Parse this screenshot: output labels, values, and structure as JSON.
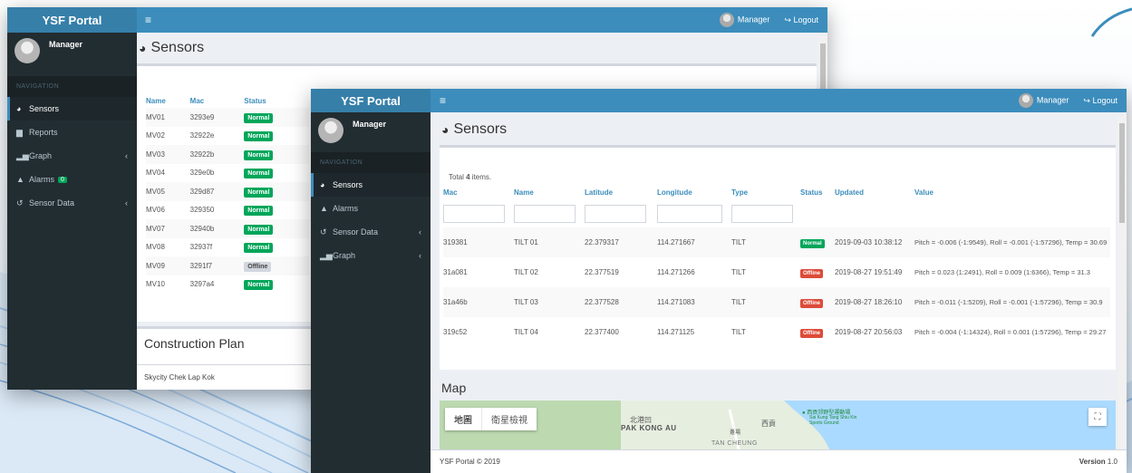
{
  "back": {
    "brand": "YSF Portal",
    "menu_icon": "≡",
    "user": "Manager",
    "logout": "Logout",
    "sidebar_user": "Manager",
    "nav_header": "NAVIGATION",
    "nav": [
      {
        "label": "Sensors",
        "icon": "dashboard-icon",
        "active": true
      },
      {
        "label": "Reports",
        "icon": "file-icon"
      },
      {
        "label": "Graph",
        "icon": "chart-icon",
        "chev": true
      },
      {
        "label": "Alarms",
        "icon": "bell-icon",
        "badge": "0"
      },
      {
        "label": "Sensor Data",
        "icon": "history-icon",
        "chev": true
      }
    ],
    "page_title": "Sensors",
    "columns": [
      "Name",
      "Mac",
      "Status"
    ],
    "rows": [
      {
        "name": "MV01",
        "mac": "3293e9",
        "status": "Normal"
      },
      {
        "name": "MV02",
        "mac": "32922e",
        "status": "Normal"
      },
      {
        "name": "MV03",
        "mac": "32922b",
        "status": "Normal"
      },
      {
        "name": "MV04",
        "mac": "329e0b",
        "status": "Normal"
      },
      {
        "name": "MV05",
        "mac": "329d87",
        "status": "Normal"
      },
      {
        "name": "MV06",
        "mac": "329350",
        "status": "Normal"
      },
      {
        "name": "MV07",
        "mac": "32940b",
        "status": "Normal"
      },
      {
        "name": "MV08",
        "mac": "32937f",
        "status": "Normal"
      },
      {
        "name": "MV09",
        "mac": "3291f7",
        "status": "Offline"
      },
      {
        "name": "MV10",
        "mac": "3297a4",
        "status": "Normal"
      }
    ],
    "section2": "Construction Plan",
    "footer": "Skycity Chek Lap Kok"
  },
  "front": {
    "brand": "YSF Portal",
    "menu_icon": "≡",
    "user": "Manager",
    "logout": "Logout",
    "sidebar_user": "Manager",
    "nav_header": "NAVIGATION",
    "nav": [
      {
        "label": "Sensors",
        "icon": "dashboard-icon",
        "active": true
      },
      {
        "label": "Alarms",
        "icon": "bell-icon"
      },
      {
        "label": "Sensor Data",
        "icon": "history-icon",
        "chev": true
      },
      {
        "label": "Graph",
        "icon": "chart-icon",
        "chev": true
      }
    ],
    "page_title": "Sensors",
    "total_prefix": "Total ",
    "total_count": "4",
    "total_suffix": " items.",
    "columns": [
      "Mac",
      "Name",
      "Latitude",
      "Longitude",
      "Type",
      "Status",
      "Updated",
      "Value"
    ],
    "rows": [
      {
        "mac": "319381",
        "name": "TILT 01",
        "lat": "22.379317",
        "lng": "114.271667",
        "type": "TILT",
        "status": "Normal",
        "updated": "2019-09-03 10:38:12",
        "value": "Pitch = -0.006 (-1:9549), Roll = -0.001 (-1:57296), Temp = 30.69"
      },
      {
        "mac": "31a081",
        "name": "TILT 02",
        "lat": "22.377519",
        "lng": "114.271266",
        "type": "TILT",
        "status": "Offline",
        "updated": "2019-08-27 19:51:49",
        "value": "Pitch = 0.023 (1:2491), Roll = 0.009 (1:6366), Temp = 31.3"
      },
      {
        "mac": "31a46b",
        "name": "TILT 03",
        "lat": "22.377528",
        "lng": "114.271083",
        "type": "TILT",
        "status": "Offline",
        "updated": "2019-08-27 18:26:10",
        "value": "Pitch = -0.011 (-1:5209), Roll = -0.001 (-1:57296), Temp = 30.9"
      },
      {
        "mac": "319c52",
        "name": "TILT 04",
        "lat": "22.377400",
        "lng": "114.271125",
        "type": "TILT",
        "status": "Offline",
        "updated": "2019-08-27 20:56:03",
        "value": "Pitch = -0.004 (-1:14324), Roll = 0.001 (1:57296), Temp = 29.27"
      }
    ],
    "map_title": "Map",
    "map_tab_map": "地圖",
    "map_tab_sat": "衛星檢視",
    "map_label_1": "北港凹",
    "map_label_2": "PAK KONG AU",
    "map_label_3": "西貢",
    "map_label_4": "西貢郊野型運動場",
    "map_label_5": "Sai Kung Tang Shiu Kin Sports Ground",
    "map_label_6": "TAN CHEUNG",
    "map_label_7": "躉場",
    "footer_left": "YSF Portal © 2019",
    "footer_version_label": "Version",
    "footer_version": "1.0"
  }
}
